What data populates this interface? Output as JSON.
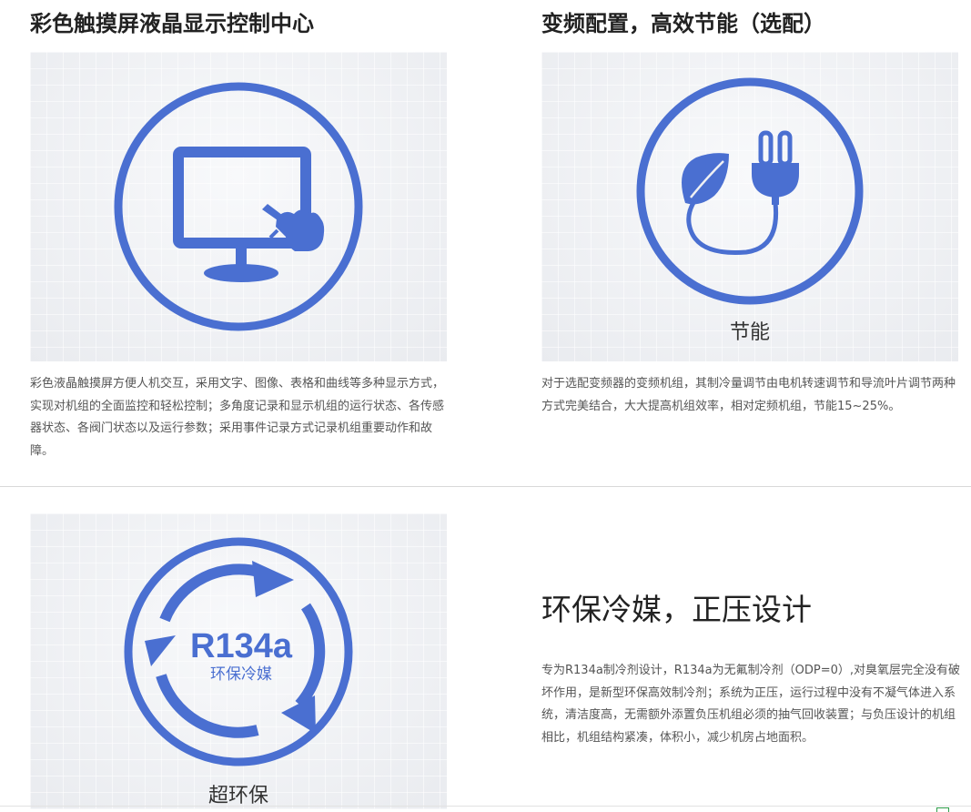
{
  "sections": {
    "touchscreen": {
      "title": "彩色触摸屏液晶显示控制中心",
      "icon": "monitor-touch-icon",
      "description": "彩色液晶触摸屏方便人机交互，采用文字、图像、表格和曲线等多种显示方式，实现对机组的全面监控和轻松控制；多角度记录和显示机组的运行状态、各传感器状态、各阀门状态以及运行参数；采用事件记录方式记录机组重要动作和故障。"
    },
    "energy": {
      "title": "变频配置，高效节能（选配）",
      "icon": "leaf-plug-icon",
      "caption": "节能",
      "description": "对于选配变频器的变频机组，其制冷量调节由电机转速调节和导流叶片调节两种方式完美结合，大大提高机组效率，相对定频机组，节能15~25%。"
    },
    "refrigerant": {
      "title": "环保冷媒，正压设计",
      "icon": "recycle-arrows-icon",
      "badge_main": "R134a",
      "badge_sub": "环保冷媒",
      "caption": "超环保",
      "description": "专为R134a制冷剂设计，R134a为无氟制冷剂（ODP=0）,对臭氧层完全没有破坏作用，是新型环保高效制冷剂；系统为正压，运行过程中没有不凝气体进入系统，清洁度高，无需额外添置负压机组必须的抽气回收装置；与负压设计的机组相比，机组结构紧凑，体积小，减少机房占地面积。"
    }
  },
  "colors": {
    "accent_blue": "#4a6fd1",
    "panel_bg": "#eff0f3",
    "title_text": "#222222",
    "body_text": "#555555",
    "divider": "#d8d8d8"
  }
}
